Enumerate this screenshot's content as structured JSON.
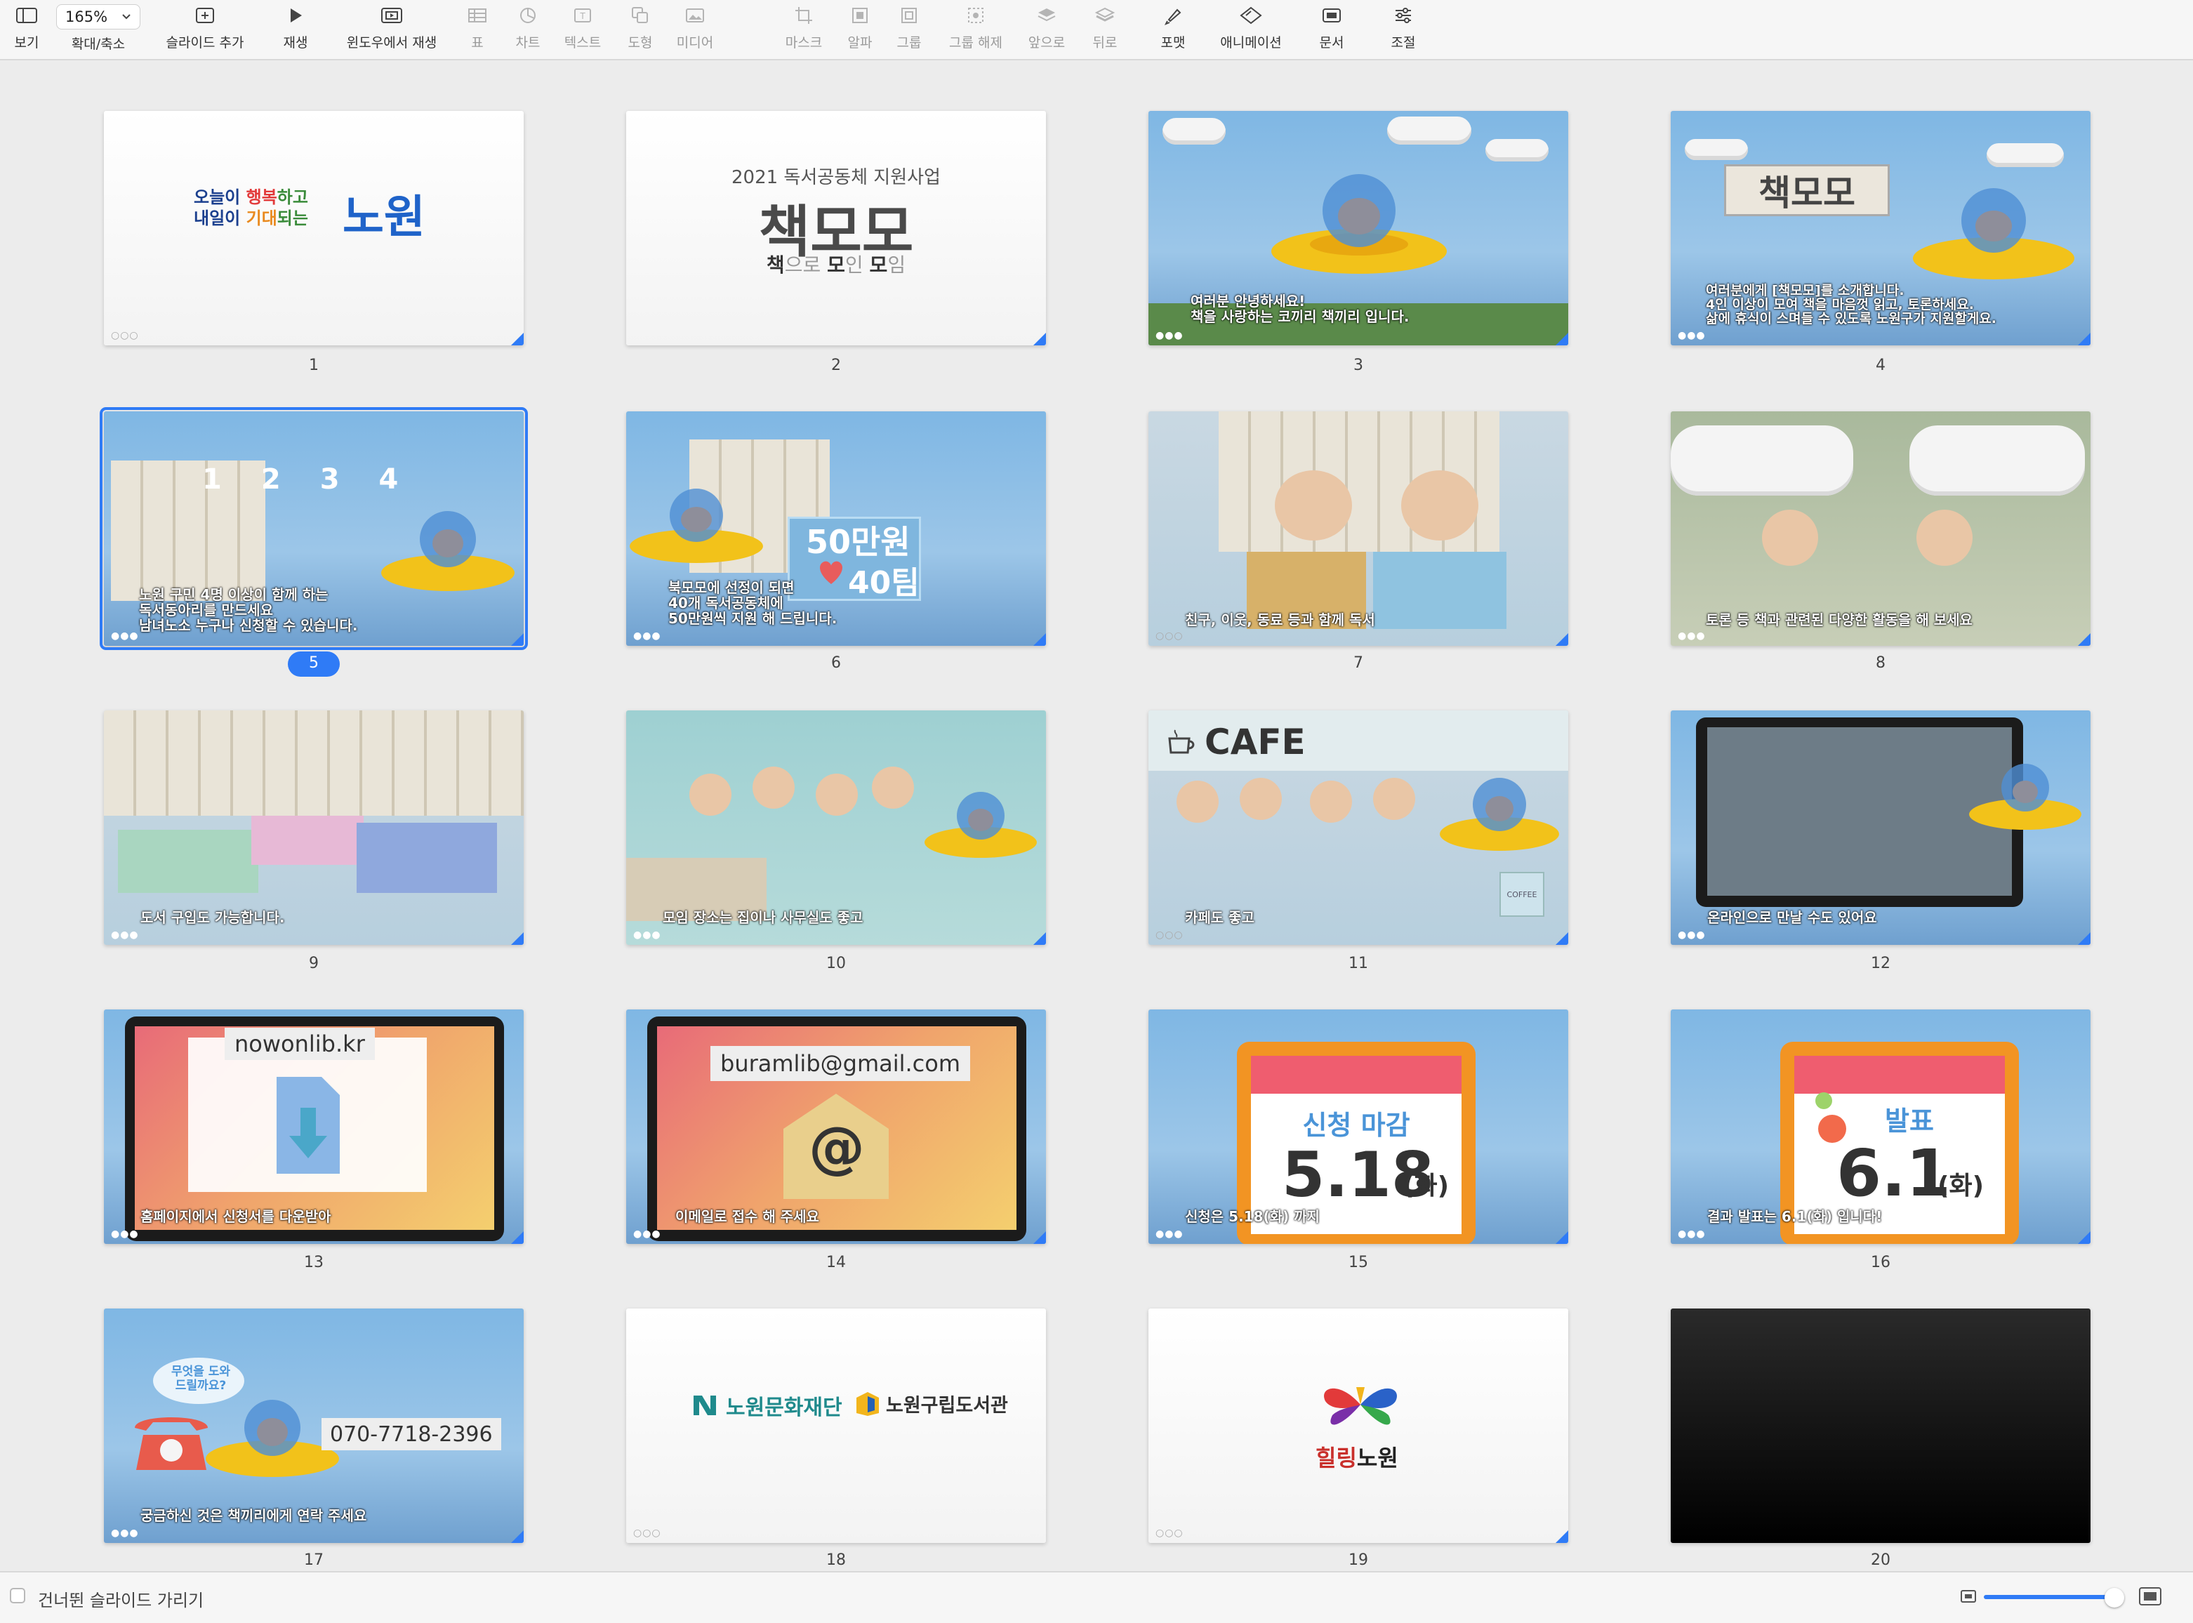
{
  "toolbar": {
    "view": "보기",
    "zoom_value": "165%",
    "zoom": "확대/축소",
    "add_slide": "슬라이드 추가",
    "play": "재생",
    "play_window": "윈도우에서 재생",
    "table": "표",
    "chart": "차트",
    "text": "텍스트",
    "shape": "도형",
    "media": "미디어",
    "mask": "마스크",
    "alpha": "알파",
    "group": "그룹",
    "ungroup": "그룹 해제",
    "front": "앞으로",
    "back": "뒤로",
    "format": "포맷",
    "animate": "애니메이션",
    "document": "문서",
    "adjust": "조절"
  },
  "slides": [
    {
      "number": "1",
      "line1a": "오늘이 ",
      "line1b": "행복",
      "line1c": "하고",
      "line2a": "내일이 ",
      "line2b": "기대",
      "line2c": "되는",
      "logo": "노원"
    },
    {
      "number": "2",
      "subtitle": "2021 독서공동체 지원사업",
      "title": "책모모",
      "tag_a": "책",
      "tag_b": "으로 ",
      "tag_c": "모",
      "tag_d": "인 ",
      "tag_e": "모",
      "tag_f": "임"
    },
    {
      "number": "3",
      "caption1": "여러분 안녕하세요!",
      "caption2": "책을 사랑하는 코끼리 책끼리 입니다."
    },
    {
      "number": "4",
      "sign": "책모모",
      "caption1": "여러분에게 [책모모]를 소개합니다.",
      "caption2": "4인 이상이 모여 책을 마음껏 읽고, 토론하세요.",
      "caption3": "삶에 휴식이 스며들 수 있도록 노원구가 지원할게요."
    },
    {
      "number": "5",
      "n1": "1",
      "n2": "2",
      "n3": "3",
      "n4": "4",
      "caption1": "노원 구민 4명 이상이 함께 하는",
      "caption2": "독서동아리를 만드세요",
      "caption3": "남녀노소 누구나 신청할 수 있습니다."
    },
    {
      "number": "6",
      "big1": "50만원",
      "big2": "40팀",
      "caption1": "북모모에 선정이 되면",
      "caption2": "40개 독서공동체에",
      "caption3": "50만원씩 지원 해 드립니다."
    },
    {
      "number": "7",
      "caption1": "친구, 이웃, 동료 등과 함께 독서"
    },
    {
      "number": "8",
      "caption1": "토론 등 책과 관련된 다양한 활동을 해 보세요"
    },
    {
      "number": "9",
      "caption1": "도서 구입도 가능합니다."
    },
    {
      "number": "10",
      "caption1": "모임 장소는 집이나 사무실도 좋고"
    },
    {
      "number": "11",
      "sign": "CAFE",
      "cup": "COFFEE",
      "caption1": "카페도 좋고"
    },
    {
      "number": "12",
      "caption1": "온라인으로 만날 수도 있어요"
    },
    {
      "number": "13",
      "url": "nowonlib.kr",
      "caption1": "홈페이지에서 신청서를 다운받아"
    },
    {
      "number": "14",
      "email": "buramlib@gmail.com",
      "at": "@",
      "caption1": "이메일로 접수 해 주세요"
    },
    {
      "number": "15",
      "cal_head": "신청 마감",
      "cal_date": "5.18",
      "cal_day": "(화)",
      "caption1": "신청은 5.18(화) 까지"
    },
    {
      "number": "16",
      "cal_head": "발표",
      "cal_date": "6.1",
      "cal_day": "(화)",
      "caption1": "결과 발표는 6.1(화) 입니다!"
    },
    {
      "number": "17",
      "bubble1": "무엇을 도와",
      "bubble2": "드릴까요?",
      "phone": "070-7718-2396",
      "caption1": "궁금하신 것은 책끼리에게 연락 주세요"
    },
    {
      "number": "18",
      "org1": "노원문화재단",
      "org2": "노원구립도서관"
    },
    {
      "number": "19",
      "logo1": "힐링",
      "logo2": "노원"
    },
    {
      "number": "20"
    }
  ],
  "dots": "●●●",
  "dots_hollow": "○○○",
  "bottom": {
    "hide_skipped": "건너뛴 슬라이드 가리기"
  },
  "colors": {
    "accent": "#2f7bf6"
  }
}
